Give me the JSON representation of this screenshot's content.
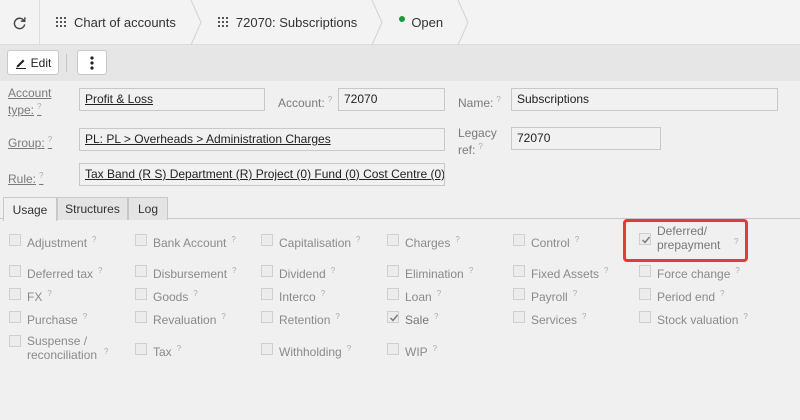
{
  "breadcrumbs": {
    "items": [
      {
        "label": "Chart of accounts",
        "icon": "grid-icon"
      },
      {
        "label": "72070: Subscriptions",
        "icon": "grid-icon"
      },
      {
        "label": "Open",
        "icon": "status-dot",
        "status_color": "#1a9b3a"
      }
    ]
  },
  "toolbar": {
    "edit_label": "Edit",
    "more_icon": "kebab-icon"
  },
  "form": {
    "account_type": {
      "label": "Account type:",
      "value": "Profit & Loss"
    },
    "account": {
      "label": "Account:",
      "value": "72070"
    },
    "name": {
      "label": "Name:",
      "value": "Subscriptions"
    },
    "group": {
      "label": "Group:",
      "value": "PL: PL > Overheads > Administration Charges"
    },
    "legacy_ref": {
      "label": "Legacy ref:",
      "value": "72070"
    },
    "rule": {
      "label": "Rule:",
      "value": "Tax Band (R S) Department (R) Project (0) Fund (0) Cost Centre (0)"
    },
    "help_glyph": "?"
  },
  "tabs": [
    {
      "label": "Usage",
      "active": true
    },
    {
      "label": "Structures",
      "active": false
    },
    {
      "label": "Log",
      "active": false
    }
  ],
  "usage": {
    "options": [
      {
        "label": "Adjustment",
        "checked": false
      },
      {
        "label": "Bank Account",
        "checked": false
      },
      {
        "label": "Capitalisation",
        "checked": false
      },
      {
        "label": "Charges",
        "checked": false
      },
      {
        "label": "Control",
        "checked": false
      },
      {
        "label": "Deferred/ prepayment",
        "checked": true
      },
      {
        "label": "Deferred tax",
        "checked": false
      },
      {
        "label": "Disbursement",
        "checked": false
      },
      {
        "label": "Dividend",
        "checked": false
      },
      {
        "label": "Elimination",
        "checked": false
      },
      {
        "label": "Fixed Assets",
        "checked": false
      },
      {
        "label": "Force change",
        "checked": false
      },
      {
        "label": "FX",
        "checked": false
      },
      {
        "label": "Goods",
        "checked": false
      },
      {
        "label": "Interco",
        "checked": false
      },
      {
        "label": "Loan",
        "checked": false
      },
      {
        "label": "Payroll",
        "checked": false
      },
      {
        "label": "Period end",
        "checked": false
      },
      {
        "label": "Purchase",
        "checked": false
      },
      {
        "label": "Revaluation",
        "checked": false
      },
      {
        "label": "Retention",
        "checked": false
      },
      {
        "label": "Sale",
        "checked": true
      },
      {
        "label": "Services",
        "checked": false
      },
      {
        "label": "Stock valuation",
        "checked": false
      },
      {
        "label": "Suspense / reconciliation",
        "checked": false
      },
      {
        "label": "Tax",
        "checked": false
      },
      {
        "label": "Withholding",
        "checked": false
      },
      {
        "label": "WIP",
        "checked": false
      }
    ],
    "highlight_color": "#e03c3c"
  }
}
